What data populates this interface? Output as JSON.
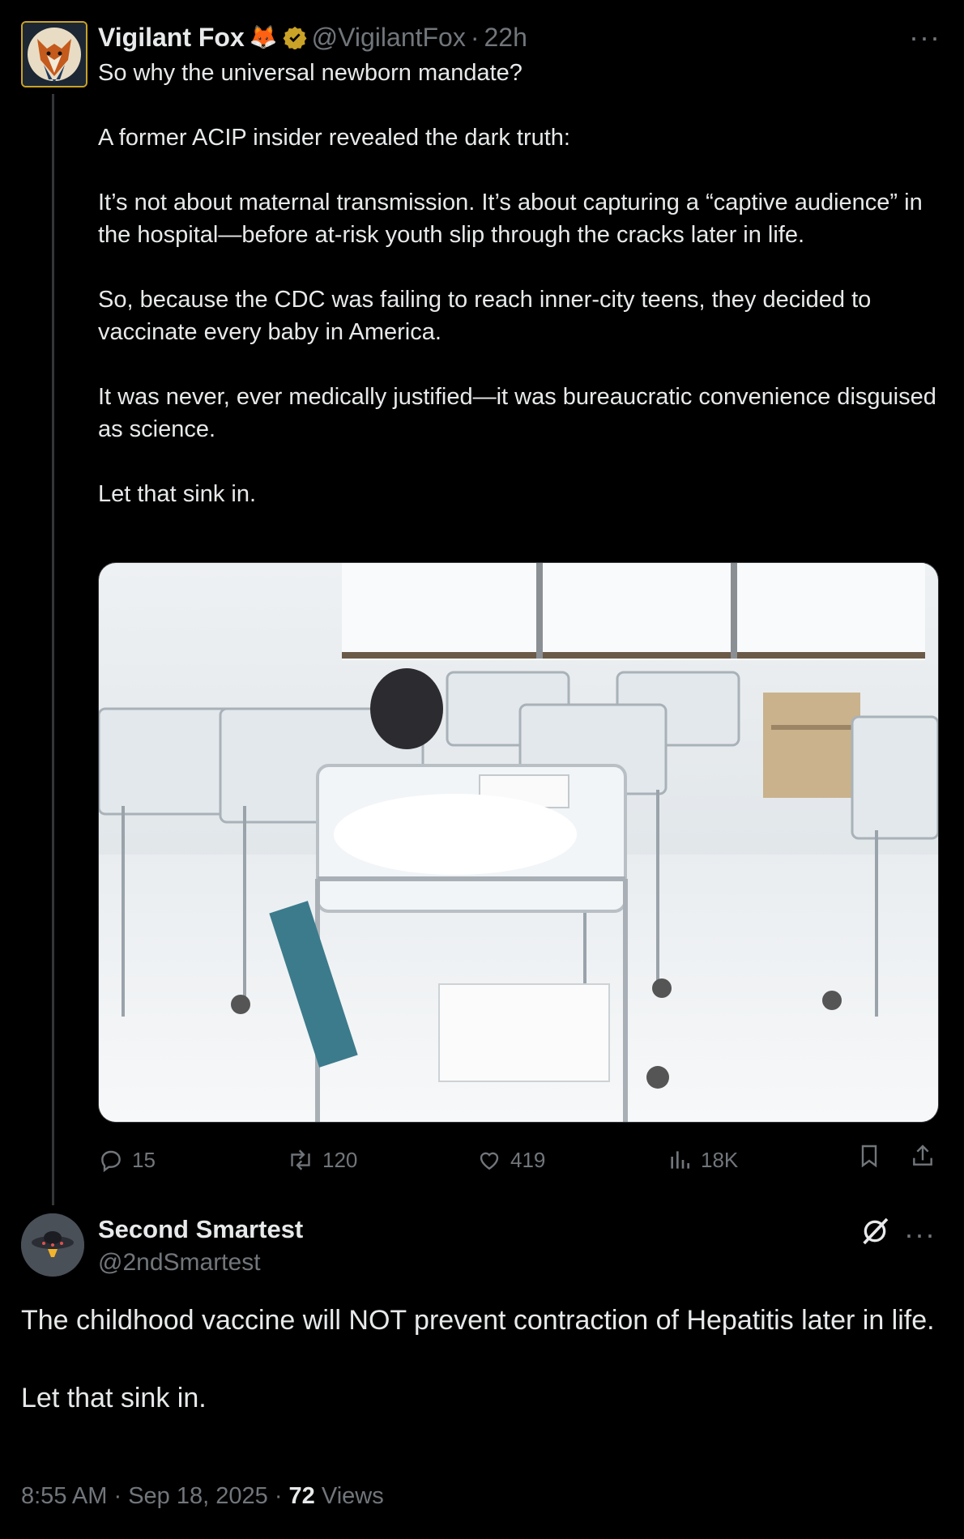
{
  "tweet": {
    "display_name": "Vigilant Fox",
    "name_emoji": "🦊",
    "handle": "@VigilantFox",
    "separator": "·",
    "time_ago": "22h",
    "text": "So why the universal newborn mandate?\n\nA former ACIP insider revealed the dark truth:\n\nIt’s not about maternal transmission. It’s about capturing a “captive audience” in the hospital—before at-risk youth slip through the cracks later in life.\n\nSo, because the CDC was failing to reach inner-city teens, they decided to vaccinate every baby in America.\n\nIt was never, ever medically justified—it was bureaucratic convenience disguised as science.\n\nLet that sink in.",
    "more_label": "···",
    "stats": {
      "replies": "15",
      "reposts": "120",
      "likes": "419",
      "views": "18K"
    }
  },
  "reply": {
    "display_name": "Second Smartest",
    "handle": "@2ndSmartest",
    "more_label": "···",
    "text": "The childhood vaccine will NOT prevent contraction of Hepatitis later in life.\n\nLet that sink in.",
    "time": "8:55 AM",
    "separator": "·",
    "date": "Sep 18, 2025",
    "views_count": "72",
    "views_label": "Views"
  },
  "colors": {
    "background": "#000000",
    "text": "#e7e9ea",
    "muted": "#71767b",
    "verified_gold": "#c9a227",
    "divider": "#333639"
  }
}
